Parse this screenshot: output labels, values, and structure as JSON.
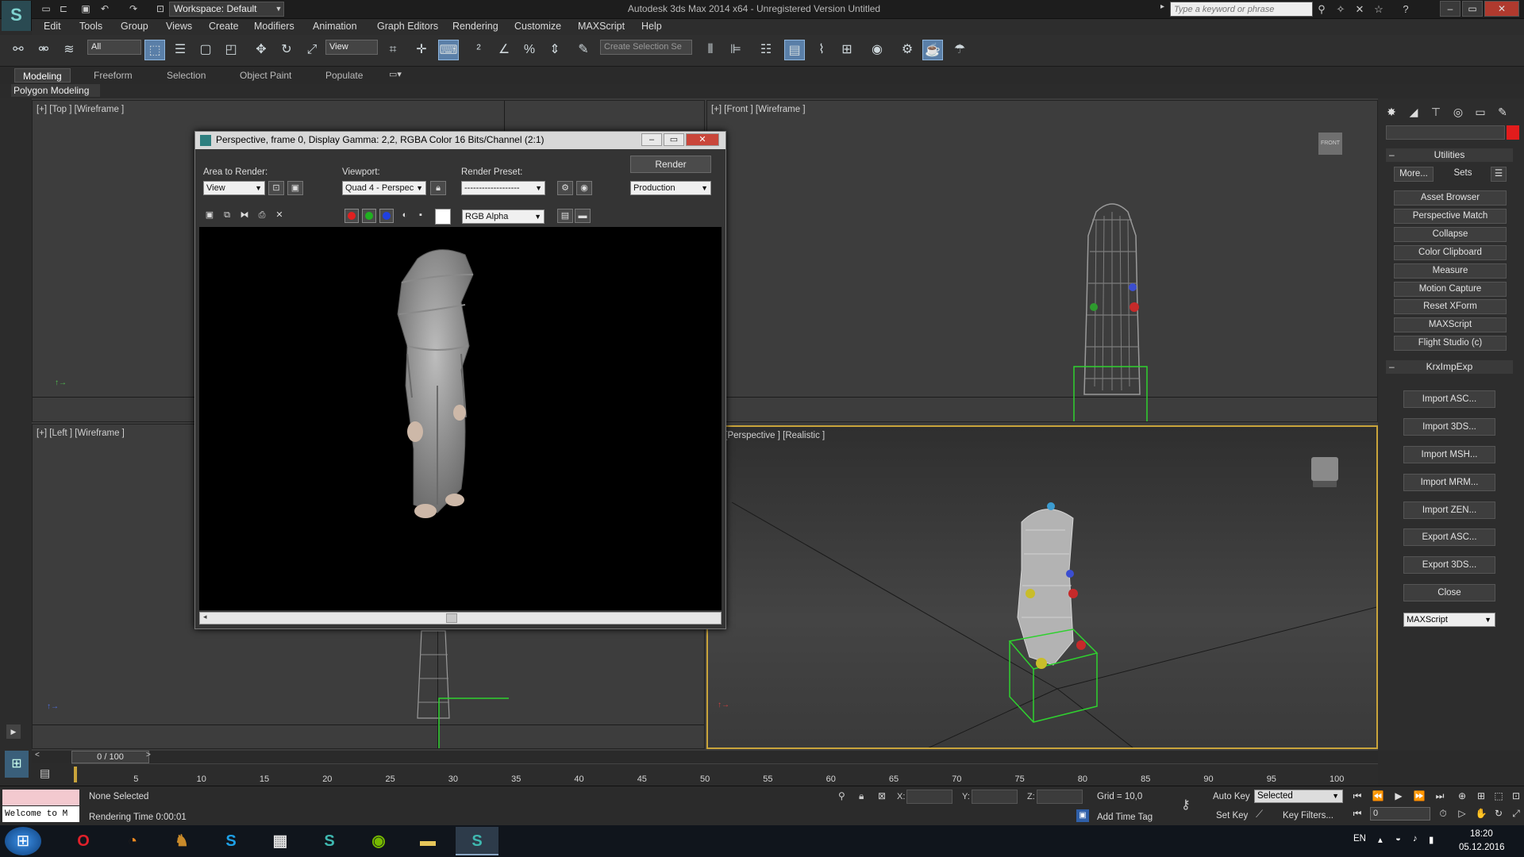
{
  "titlebar": {
    "workspace": "Workspace: Default",
    "title": "Autodesk 3ds Max 2014 x64  -  Unregistered Version   Untitled",
    "search_placeholder": "Type a keyword or phrase"
  },
  "menu": [
    "Edit",
    "Tools",
    "Group",
    "Views",
    "Create",
    "Modifiers",
    "Animation",
    "Graph Editors",
    "Rendering",
    "Customize",
    "MAXScript",
    "Help"
  ],
  "toolbar": {
    "selection_filter": "All",
    "reference_coord": "View",
    "named_selection_placeholder": "Create Selection Se"
  },
  "ribbon": {
    "tabs": [
      "Modeling",
      "Freeform",
      "Selection",
      "Object Paint",
      "Populate"
    ],
    "active_panel": "Polygon Modeling"
  },
  "viewports": {
    "top": "[+] [Top ] [Wireframe ]",
    "front": "[+] [Front ] [Wireframe ]",
    "left": "[+] [Left ] [Wireframe ]",
    "perspective": "[+] [Perspective ] [Realistic ]",
    "viewcube_front": "FRONT"
  },
  "render_window": {
    "title": "Perspective, frame 0, Display Gamma: 2,2, RGBA Color 16 Bits/Channel (2:1)",
    "area_label": "Area to Render:",
    "area_value": "View",
    "viewport_label": "Viewport:",
    "viewport_value": "Quad 4 - Perspec",
    "preset_label": "Render Preset:",
    "preset_value": "-------------------",
    "render_button": "Render",
    "production_value": "Production",
    "channel_value": "RGB Alpha"
  },
  "command_panel": {
    "utilities_title": "Utilities",
    "more_button": "More...",
    "sets_button": "Sets",
    "utilities": [
      "Asset Browser",
      "Perspective Match",
      "Collapse",
      "Color Clipboard",
      "Measure",
      "Motion Capture",
      "Reset XForm",
      "MAXScript",
      "Flight Studio (c)"
    ],
    "krx_title": "KrxImpExp",
    "krx_buttons": [
      "Import ASC...",
      "Import 3DS...",
      "Import MSH...",
      "Import MRM...",
      "Import ZEN...",
      "Export ASC...",
      "Export 3DS...",
      "Close"
    ],
    "krx_dropdown": "MAXScript"
  },
  "timeline": {
    "frame_range": "0 / 100",
    "ticks": [
      "5",
      "10",
      "15",
      "20",
      "25",
      "30",
      "35",
      "40",
      "45",
      "50",
      "55",
      "60",
      "65",
      "70",
      "75",
      "80",
      "85",
      "90",
      "95",
      "100"
    ]
  },
  "status": {
    "listener_text": "Welcome to M",
    "selection": "None Selected",
    "render_time": "Rendering Time  0:00:01",
    "x_label": "X:",
    "y_label": "Y:",
    "z_label": "Z:",
    "grid": "Grid = 10,0",
    "add_time_tag": "Add Time Tag",
    "auto_key": "Auto Key",
    "set_key": "Set Key",
    "selected_dropdown": "Selected",
    "key_filters": "Key Filters...",
    "current_frame": "0"
  },
  "taskbar": {
    "language": "EN",
    "time": "18:20",
    "date": "05.12.2016"
  }
}
